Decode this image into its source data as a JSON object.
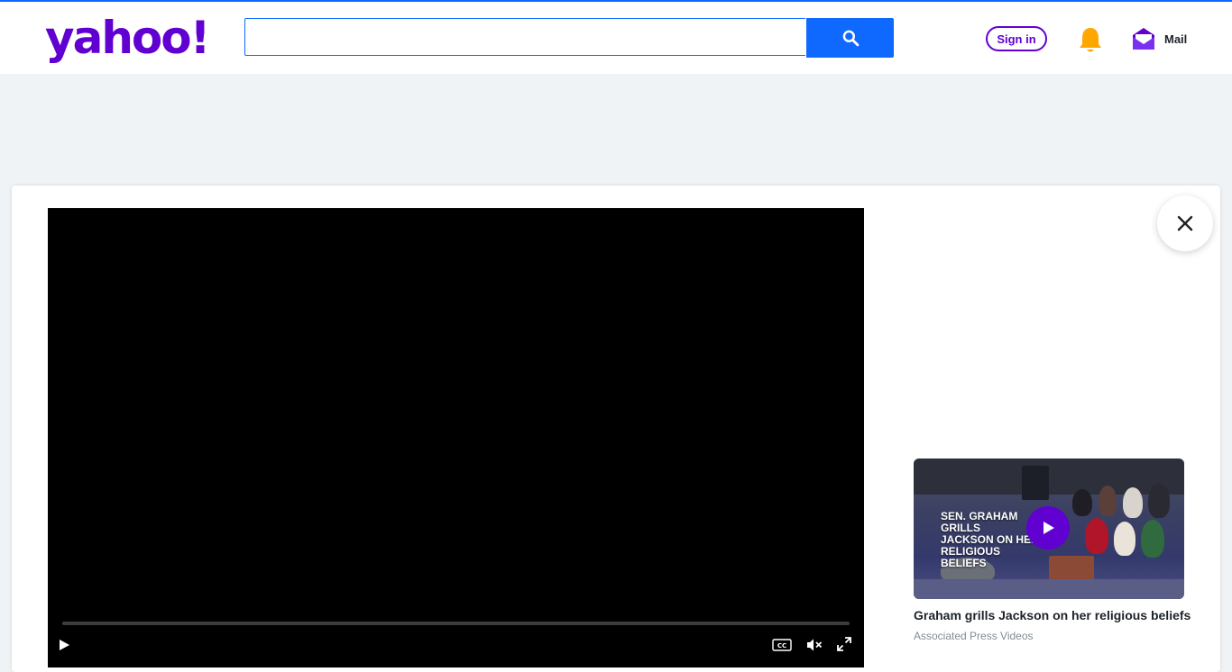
{
  "header": {
    "logo_text": "yahoo!",
    "search": {
      "placeholder": "",
      "value": ""
    },
    "signin_label": "Sign in",
    "mail_label": "Mail"
  },
  "colors": {
    "brand": "#6001d2",
    "accent": "#0f69ff",
    "notification": "#ffa700"
  },
  "icons": {
    "search": "search-icon",
    "bell": "bell-icon",
    "mail": "mail-icon",
    "close": "close-icon",
    "play": "play-icon",
    "captions": "cc-icon",
    "mute": "mute-icon",
    "fullscreen": "fullscreen-icon"
  },
  "player": {
    "progress_fraction": 0.0
  },
  "up_next": {
    "thumbnail_text": "SEN. GRAHAM GRILLS\nJACKSON ON HER\nRELIGIOUS BELIEFS",
    "title": "Graham grills Jackson on her religious beliefs",
    "source": "Associated Press Videos"
  }
}
